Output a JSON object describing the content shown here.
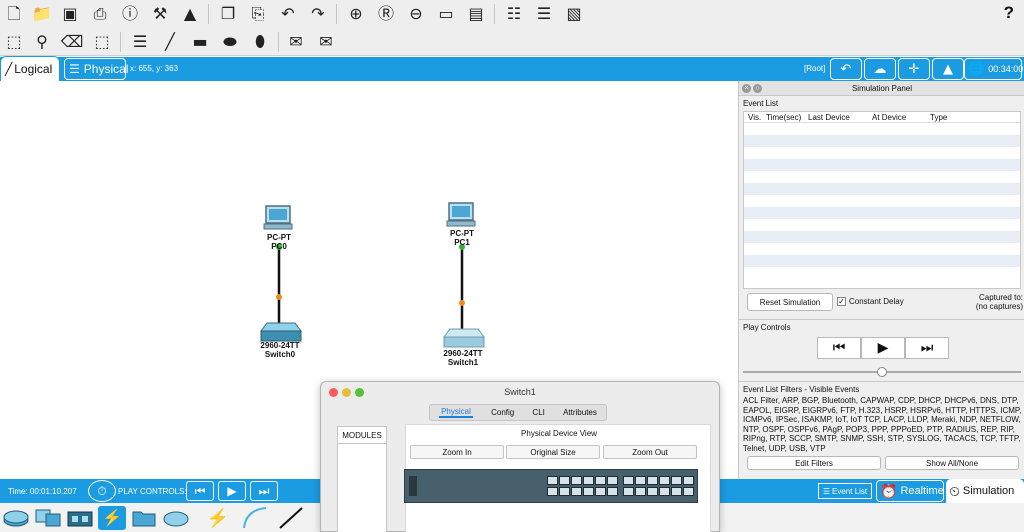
{
  "toolbar1": {
    "icons": [
      "new-icon",
      "open-icon",
      "save-icon",
      "print-icon",
      "info-icon",
      "wizard-icon",
      "network-info-icon",
      "copy-icon",
      "paste-icon",
      "undo-icon",
      "redo-icon",
      "zoom-in-icon",
      "zoom-reset-icon",
      "zoom-out-icon",
      "drawing-palette-icon",
      "custom-device-icon",
      "pdu-icon",
      "cluster-icon",
      "screenshot-icon"
    ],
    "help_label": "?"
  },
  "toolbar2": {
    "icons": [
      "select-icon",
      "inspect-icon",
      "delete-icon",
      "resize-icon",
      "note-icon",
      "line-icon",
      "rectangle-icon",
      "ellipse-icon",
      "freeform-icon",
      "simple-pdu-icon",
      "complex-pdu-icon"
    ]
  },
  "view_tabs": {
    "logical": "Logical",
    "physical": "Physical",
    "coords": "x: 655, y: 363",
    "root": "[Root]",
    "clock": "00:34:00"
  },
  "workspace": {
    "devices": [
      {
        "type": "PC-PT",
        "name": "PC0"
      },
      {
        "type": "PC-PT",
        "name": "PC1"
      },
      {
        "type": "2960-24TT",
        "name": "Switch0"
      },
      {
        "type": "2960-24TT",
        "name": "Switch1"
      }
    ]
  },
  "sim_panel": {
    "title": "Simulation Panel",
    "event_list_label": "Event List",
    "columns": [
      "Vis.",
      "Time(sec)",
      "Last Device",
      "At Device",
      "Type"
    ],
    "reset_button": "Reset Simulation",
    "constant_delay_label": "Constant Delay",
    "constant_delay_checked": true,
    "captured_to": "Captured to:",
    "no_captures": "(no captures)",
    "play_controls_label": "Play Controls",
    "filters_label": "Event List Filters - Visible Events",
    "filters_text": "ACL Filter, ARP, BGP, Bluetooth, CAPWAP, CDP, DHCP, DHCPv6, DNS, DTP, EAPOL, EIGRP, EIGRPv6, FTP, H.323, HSRP, HSRPv6, HTTP, HTTPS, ICMP, ICMPv6, IPSec, ISAKMP, IoT, IoT TCP, LACP, LLDP, Meraki, NDP, NETFLOW, NTP, OSPF, OSPFv6, PAgP, POP3, PPP, PPPoED, PTP, RADIUS, REP, RIP, RIPng, RTP, SCCP, SMTP, SNMP, SSH, STP, SYSLOG, TACACS, TCP, TFTP, Telnet, UDP, USB, VTP",
    "edit_filters": "Edit Filters",
    "show_all": "Show All/None"
  },
  "bottom_bar": {
    "time": "Time: 00:01:10.207",
    "play_controls": "PLAY CONTROLS:",
    "event_list": "Event List",
    "realtime": "Realtime",
    "simulation": "Simulation"
  },
  "switch_window": {
    "title": "Switch1",
    "tabs": [
      "Physical",
      "Config",
      "CLI",
      "Attributes"
    ],
    "active_tab": "Physical",
    "modules_label": "MODULES",
    "pdv_title": "Physical Device View",
    "zoom_in": "Zoom In",
    "original_size": "Original Size",
    "zoom_out": "Zoom Out"
  },
  "colors": {
    "accent": "#1b9be2",
    "link_green": "#2fb52f",
    "link_orange": "#f08a1c"
  }
}
